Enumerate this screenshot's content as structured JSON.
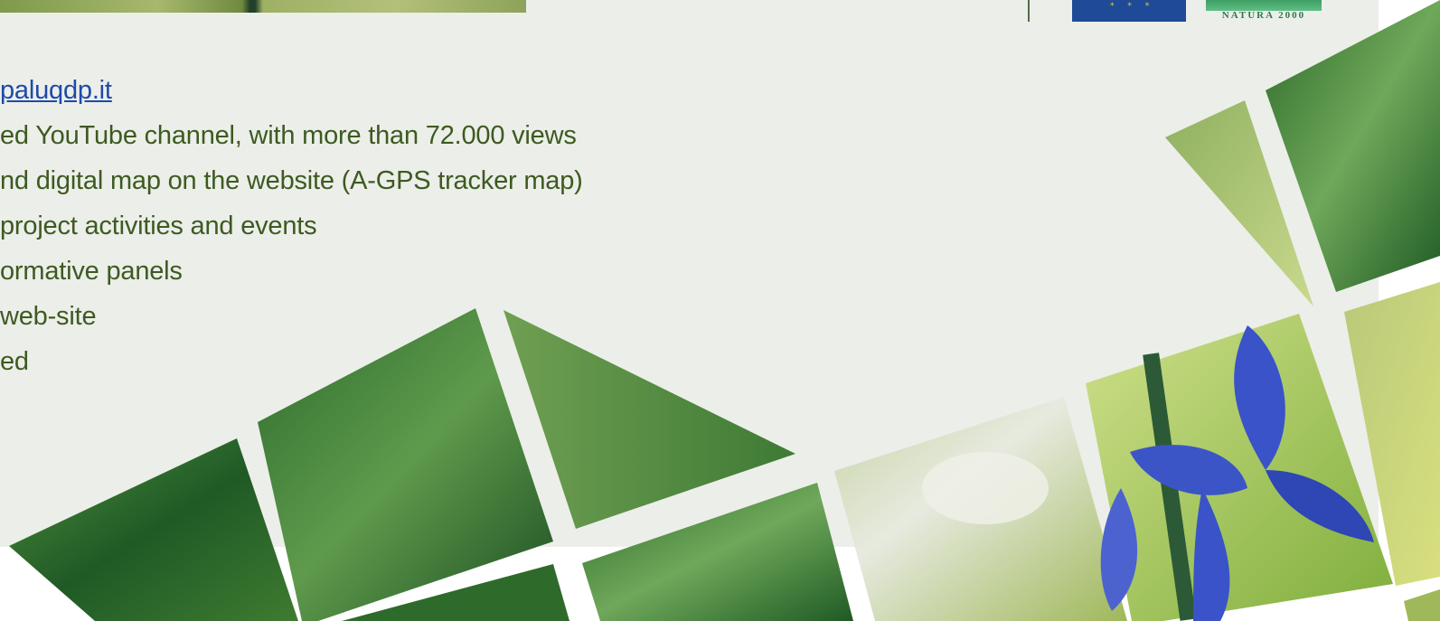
{
  "header": {
    "divider": "|",
    "eu_flag_stars": "* * *",
    "natura_label": "NATURA 2000"
  },
  "content": {
    "lines": [
      {
        "text": "paluqdp.it",
        "type": "link"
      },
      {
        "text": "ed YouTube channel, with more than 72.000 views",
        "type": "text"
      },
      {
        "text": "nd digital map on the website (A-GPS tracker map)",
        "type": "text"
      },
      {
        "text": "project activities and events",
        "type": "text"
      },
      {
        "text": "ormative panels",
        "type": "text"
      },
      {
        "text": "web-site",
        "type": "text"
      },
      {
        "text": "ed",
        "type": "text"
      }
    ]
  },
  "colors": {
    "text": "#3d5a21",
    "link": "#1f4aa8",
    "background": "#eceee9",
    "eu_blue": "#1f4a97",
    "natura_green": "#2d7a4b"
  },
  "decoration": {
    "photo_mosaic": "nature photo collage (green foliage and blue iris flower)"
  }
}
